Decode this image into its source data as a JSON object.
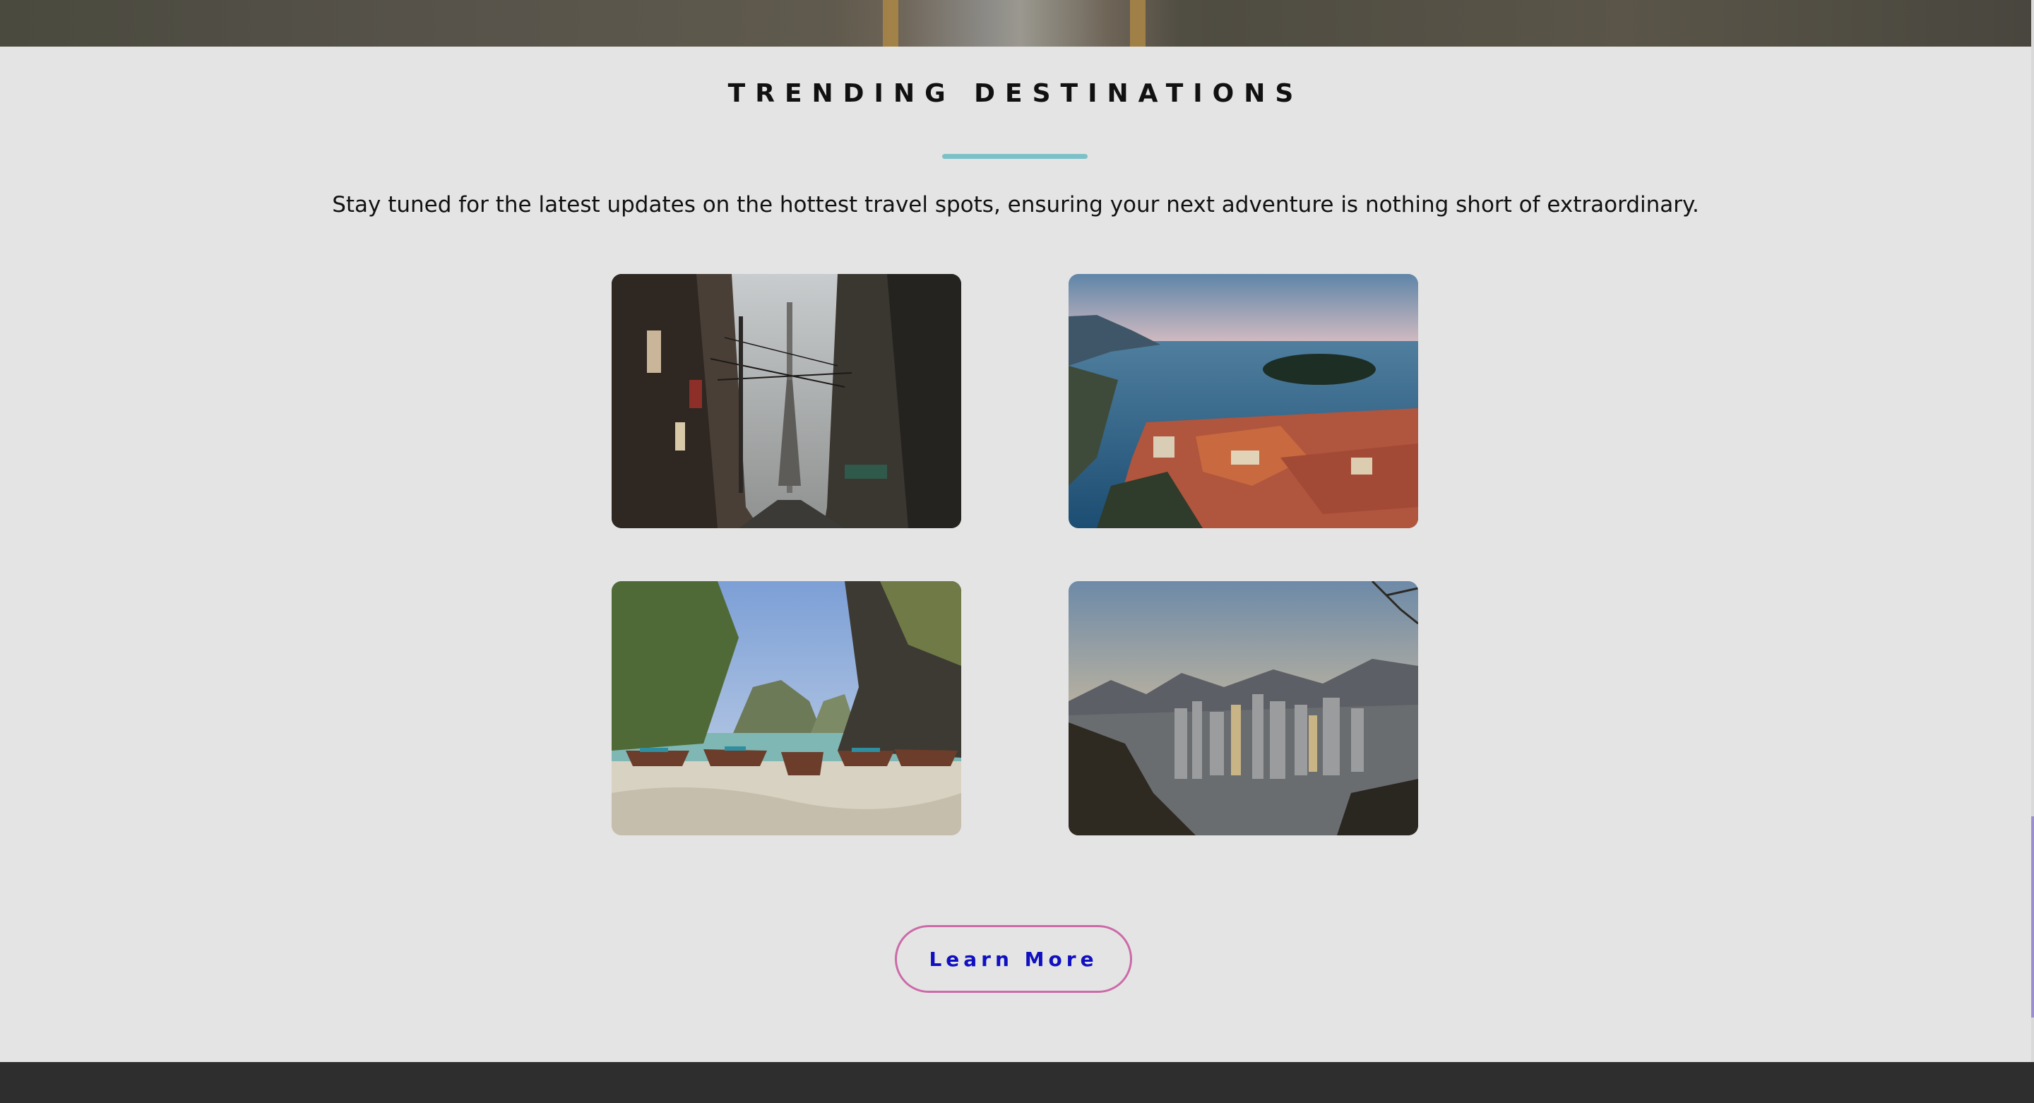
{
  "section": {
    "title": "TRENDING DESTINATIONS",
    "subtitle": "Stay tuned for the latest updates on the hottest travel spots, ensuring your next adventure is nothing short of extraordinary."
  },
  "cta": {
    "label": "Learn More"
  },
  "colors": {
    "background": "#e4e4e4",
    "divider": "#7cc1c8",
    "button_border": "#cc6aa8",
    "button_text": "#1010c0",
    "footer": "#2e2e2e"
  }
}
